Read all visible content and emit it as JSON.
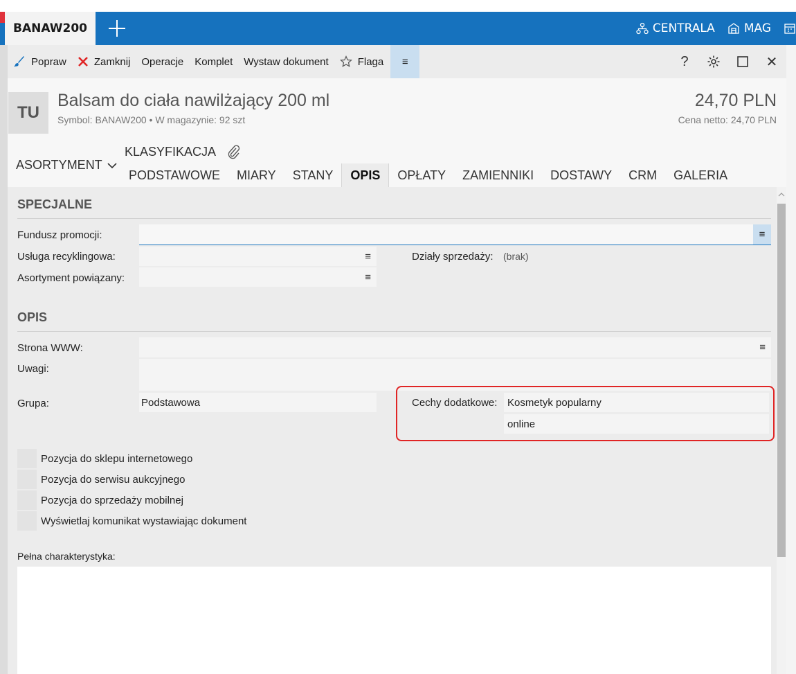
{
  "topbar": {
    "tab_label": "BANAW200",
    "centrala_label": "CENTRALA",
    "mag_label": "MAG"
  },
  "toolbar": {
    "popraw": "Popraw",
    "zamknij": "Zamknij",
    "operacje": "Operacje",
    "komplet": "Komplet",
    "wystaw": "Wystaw dokument",
    "flaga": "Flaga",
    "menu_icon": "≡",
    "help_icon": "?",
    "close_icon": "✕"
  },
  "header": {
    "avatar": "TU",
    "title": "Balsam do ciała nawilżający 200 ml",
    "subtitle": "Symbol: BANAW200  •  W magazynie: 92 szt",
    "price": "24,70 PLN",
    "netto": "Cena netto: 24,70 PLN"
  },
  "nav": {
    "asortyment": "ASORTYMENT",
    "klasyfikacja": "KLASYFIKACJA",
    "tabs": [
      "PODSTAWOWE",
      "MIARY",
      "STANY",
      "OPIS",
      "OPŁATY",
      "ZAMIENNIKI",
      "DOSTAWY",
      "CRM",
      "GALERIA"
    ],
    "active_tab": "OPIS"
  },
  "specjalne": {
    "heading": "SPECJALNE",
    "fundusz_label": "Fundusz promocji:",
    "fundusz_value": "",
    "usluga_label": "Usługa recyklingowa:",
    "usluga_value": "",
    "asort_label": "Asortyment powiązany:",
    "asort_value": "",
    "dzialy_label": "Działy sprzedaży:",
    "dzialy_value": "(brak)"
  },
  "opis": {
    "heading": "OPIS",
    "www_label": "Strona WWW:",
    "www_value": "",
    "uwagi_label": "Uwagi:",
    "uwagi_value": "",
    "grupa_label": "Grupa:",
    "grupa_value": "Podstawowa",
    "cechy_label": "Cechy dodatkowe:",
    "cechy_values": [
      "Kosmetyk popularny",
      "online"
    ],
    "checkboxes": [
      "Pozycja do sklepu internetowego",
      "Pozycja do serwisu aukcyjnego",
      "Pozycja do sprzedaży mobilnej",
      "Wyświetlaj komunikat wystawiając dokument"
    ],
    "charakterystyka_label": "Pełna charakterystyka:",
    "charakterystyka_value": ""
  }
}
